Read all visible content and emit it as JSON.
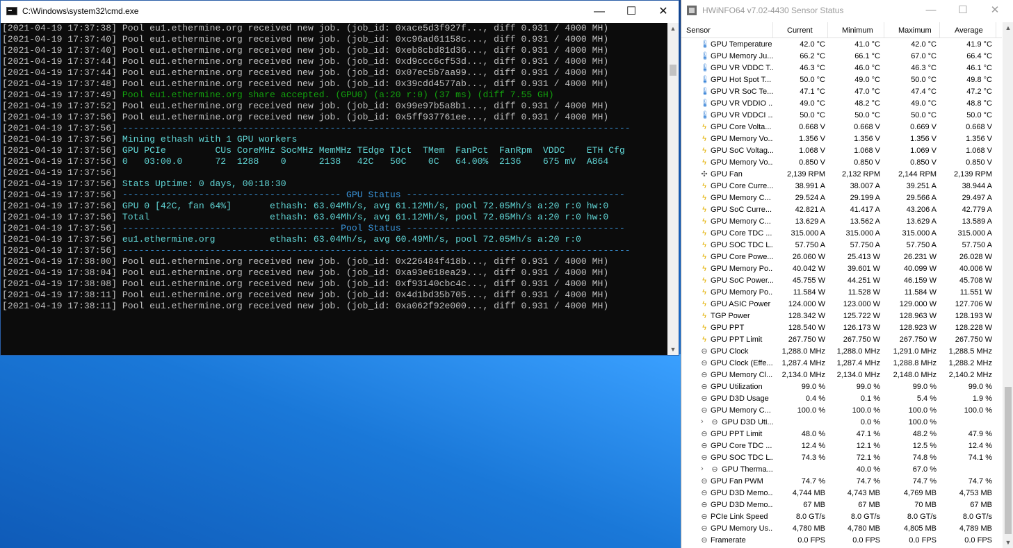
{
  "cmd": {
    "title": "C:\\Windows\\system32\\cmd.exe",
    "controls": {
      "minimize": "—",
      "maximize": "☐",
      "close": "✕"
    },
    "lines": [
      {
        "ts": "[2021-04-19 17:37:38]",
        "msg": " Pool eu1.ethermine.org received new job. (job_id: 0xace5d3f927f..., diff 0.931 / 4000 MH)",
        "color": "gray"
      },
      {
        "ts": "[2021-04-19 17:37:40]",
        "msg": " Pool eu1.ethermine.org received new job. (job_id: 0xc96ad61158c..., diff 0.931 / 4000 MH)",
        "color": "gray"
      },
      {
        "ts": "[2021-04-19 17:37:40]",
        "msg": " Pool eu1.ethermine.org received new job. (job_id: 0xeb8cbd81d36..., diff 0.931 / 4000 MH)",
        "color": "gray"
      },
      {
        "ts": "[2021-04-19 17:37:44]",
        "msg": " Pool eu1.ethermine.org received new job. (job_id: 0xd9ccc6cf53d..., diff 0.931 / 4000 MH)",
        "color": "gray"
      },
      {
        "ts": "[2021-04-19 17:37:44]",
        "msg": " Pool eu1.ethermine.org received new job. (job_id: 0x07ec5b7aa99..., diff 0.931 / 4000 MH)",
        "color": "gray"
      },
      {
        "ts": "[2021-04-19 17:37:48]",
        "msg": " Pool eu1.ethermine.org received new job. (job_id: 0x39cdd4577ab..., diff 0.931 / 4000 MH)",
        "color": "gray"
      },
      {
        "ts": "[2021-04-19 17:37:49]",
        "msg": " Pool eu1.ethermine.org share accepted. (GPU0) (a:20 r:0) (37 ms) (diff 7.55 GH)",
        "color": "green"
      },
      {
        "ts": "[2021-04-19 17:37:52]",
        "msg": " Pool eu1.ethermine.org received new job. (job_id: 0x99e97b5a8b1..., diff 0.931 / 4000 MH)",
        "color": "gray"
      },
      {
        "ts": "[2021-04-19 17:37:56]",
        "msg": " Pool eu1.ethermine.org received new job. (job_id: 0x5ff937761ee..., diff 0.931 / 4000 MH)",
        "color": "gray"
      },
      {
        "ts": "[2021-04-19 17:37:56]",
        "msg": " ---------------------------------------------------------------------------------------------",
        "color": "cyan"
      },
      {
        "ts": "[2021-04-19 17:37:56]",
        "msg": " Mining ethash with 1 GPU workers",
        "color": "teal"
      },
      {
        "ts": "[2021-04-19 17:37:56]",
        "msg": " GPU PCIe         CUs CoreMHz SocMHz MemMHz TEdge TJct  TMem  FanPct  FanRpm  VDDC    ETH Cfg",
        "color": "teal"
      },
      {
        "ts": "[2021-04-19 17:37:56]",
        "msg": " 0   03:00.0      72  1288    0      2138   42C   50C    0C   64.00%  2136    675 mV  A864",
        "color": "teal"
      },
      {
        "ts": "[2021-04-19 17:37:56]",
        "msg": "",
        "color": "gray"
      },
      {
        "ts": "[2021-04-19 17:37:56]",
        "msg": " Stats Uptime: 0 days, 00:18:30",
        "color": "teal"
      },
      {
        "ts": "[2021-04-19 17:37:56]",
        "msg": " ---------------------------------------- GPU Status ----------------------------------------",
        "color": "cyan"
      },
      {
        "ts": "[2021-04-19 17:37:56]",
        "msg": " GPU 0 [42C, fan 64%]       ethash: 63.04Mh/s, avg 61.12Mh/s, pool 72.05Mh/s a:20 r:0 hw:0",
        "color": "teal"
      },
      {
        "ts": "[2021-04-19 17:37:56]",
        "msg": " Total                      ethash: 63.04Mh/s, avg 61.12Mh/s, pool 72.05Mh/s a:20 r:0 hw:0",
        "color": "teal"
      },
      {
        "ts": "[2021-04-19 17:37:56]",
        "msg": " --------------------------------------- Pool Status ----------------------------------------",
        "color": "cyan"
      },
      {
        "ts": "[2021-04-19 17:37:56]",
        "msg": " eu1.ethermine.org          ethash: 63.04Mh/s, avg 60.49Mh/s, pool 72.05Mh/s a:20 r:0",
        "color": "teal"
      },
      {
        "ts": "[2021-04-19 17:37:56]",
        "msg": " ---------------------------------------------------------------------------------------------",
        "color": "cyan"
      },
      {
        "ts": "[2021-04-19 17:38:00]",
        "msg": " Pool eu1.ethermine.org received new job. (job_id: 0x226484f418b..., diff 0.931 / 4000 MH)",
        "color": "gray"
      },
      {
        "ts": "[2021-04-19 17:38:04]",
        "msg": " Pool eu1.ethermine.org received new job. (job_id: 0xa93e618ea29..., diff 0.931 / 4000 MH)",
        "color": "gray"
      },
      {
        "ts": "[2021-04-19 17:38:08]",
        "msg": " Pool eu1.ethermine.org received new job. (job_id: 0xf93140cbc4c..., diff 0.931 / 4000 MH)",
        "color": "gray"
      },
      {
        "ts": "[2021-04-19 17:38:11]",
        "msg": " Pool eu1.ethermine.org received new job. (job_id: 0x4d1bd35b705..., diff 0.931 / 4000 MH)",
        "color": "gray"
      },
      {
        "ts": "[2021-04-19 17:38:11]",
        "msg": " Pool eu1.ethermine.org received new job. (job_id: 0xa062f92e000..., diff 0.931 / 4000 MH)",
        "color": "gray"
      }
    ]
  },
  "hwinfo": {
    "title": "HWiNFO64 v7.02-4430 Sensor Status",
    "controls": {
      "minimize": "—",
      "maximize": "☐",
      "close": "✕"
    },
    "headers": {
      "sensor": "Sensor",
      "current": "Current",
      "minimum": "Minimum",
      "maximum": "Maximum",
      "average": "Average"
    },
    "rows": [
      {
        "icon": "temp",
        "name": "GPU Temperature",
        "cur": "42.0 °C",
        "min": "41.0 °C",
        "max": "42.0 °C",
        "avg": "41.9 °C"
      },
      {
        "icon": "temp",
        "name": "GPU Memory Ju...",
        "cur": "66.2 °C",
        "min": "66.1 °C",
        "max": "67.0 °C",
        "avg": "66.4 °C"
      },
      {
        "icon": "temp",
        "name": "GPU VR VDDC T...",
        "cur": "46.3 °C",
        "min": "46.0 °C",
        "max": "46.3 °C",
        "avg": "46.1 °C"
      },
      {
        "icon": "temp",
        "name": "GPU Hot Spot T...",
        "cur": "50.0 °C",
        "min": "49.0 °C",
        "max": "50.0 °C",
        "avg": "49.8 °C"
      },
      {
        "icon": "temp",
        "name": "GPU VR SoC Te...",
        "cur": "47.1 °C",
        "min": "47.0 °C",
        "max": "47.4 °C",
        "avg": "47.2 °C"
      },
      {
        "icon": "temp",
        "name": "GPU VR VDDIO ...",
        "cur": "49.0 °C",
        "min": "48.2 °C",
        "max": "49.0 °C",
        "avg": "48.8 °C"
      },
      {
        "icon": "temp",
        "name": "GPU VR VDDCI ...",
        "cur": "50.0 °C",
        "min": "50.0 °C",
        "max": "50.0 °C",
        "avg": "50.0 °C"
      },
      {
        "icon": "volt",
        "name": "GPU Core Volta...",
        "cur": "0.668 V",
        "min": "0.668 V",
        "max": "0.669 V",
        "avg": "0.668 V"
      },
      {
        "icon": "volt",
        "name": "GPU Memory Vo...",
        "cur": "1.356 V",
        "min": "1.356 V",
        "max": "1.356 V",
        "avg": "1.356 V"
      },
      {
        "icon": "volt",
        "name": "GPU SoC Voltag...",
        "cur": "1.068 V",
        "min": "1.068 V",
        "max": "1.069 V",
        "avg": "1.068 V"
      },
      {
        "icon": "volt",
        "name": "GPU Memory Vo...",
        "cur": "0.850 V",
        "min": "0.850 V",
        "max": "0.850 V",
        "avg": "0.850 V"
      },
      {
        "icon": "fan",
        "name": "GPU Fan",
        "cur": "2,139 RPM",
        "min": "2,132 RPM",
        "max": "2,144 RPM",
        "avg": "2,139 RPM"
      },
      {
        "icon": "volt",
        "name": "GPU Core Curre...",
        "cur": "38.991 A",
        "min": "38.007 A",
        "max": "39.251 A",
        "avg": "38.944 A"
      },
      {
        "icon": "volt",
        "name": "GPU Memory C...",
        "cur": "29.524 A",
        "min": "29.199 A",
        "max": "29.566 A",
        "avg": "29.497 A"
      },
      {
        "icon": "volt",
        "name": "GPU SoC Curre...",
        "cur": "42.821 A",
        "min": "41.417 A",
        "max": "43.206 A",
        "avg": "42.779 A"
      },
      {
        "icon": "volt",
        "name": "GPU Memory C...",
        "cur": "13.629 A",
        "min": "13.562 A",
        "max": "13.629 A",
        "avg": "13.589 A"
      },
      {
        "icon": "volt",
        "name": "GPU Core TDC ...",
        "cur": "315.000 A",
        "min": "315.000 A",
        "max": "315.000 A",
        "avg": "315.000 A"
      },
      {
        "icon": "volt",
        "name": "GPU SOC TDC L...",
        "cur": "57.750 A",
        "min": "57.750 A",
        "max": "57.750 A",
        "avg": "57.750 A"
      },
      {
        "icon": "volt",
        "name": "GPU Core Powe...",
        "cur": "26.060 W",
        "min": "25.413 W",
        "max": "26.231 W",
        "avg": "26.028 W"
      },
      {
        "icon": "volt",
        "name": "GPU Memory Po...",
        "cur": "40.042 W",
        "min": "39.601 W",
        "max": "40.099 W",
        "avg": "40.006 W"
      },
      {
        "icon": "volt",
        "name": "GPU SoC Power...",
        "cur": "45.755 W",
        "min": "44.251 W",
        "max": "46.159 W",
        "avg": "45.708 W"
      },
      {
        "icon": "volt",
        "name": "GPU Memory Po...",
        "cur": "11.584 W",
        "min": "11.528 W",
        "max": "11.584 W",
        "avg": "11.551 W"
      },
      {
        "icon": "volt",
        "name": "GPU ASIC Power",
        "cur": "124.000 W",
        "min": "123.000 W",
        "max": "129.000 W",
        "avg": "127.706 W"
      },
      {
        "icon": "volt",
        "name": "TGP Power",
        "cur": "128.342 W",
        "min": "125.722 W",
        "max": "128.963 W",
        "avg": "128.193 W"
      },
      {
        "icon": "volt",
        "name": "GPU PPT",
        "cur": "128.540 W",
        "min": "126.173 W",
        "max": "128.923 W",
        "avg": "128.228 W"
      },
      {
        "icon": "volt",
        "name": "GPU PPT Limit",
        "cur": "267.750 W",
        "min": "267.750 W",
        "max": "267.750 W",
        "avg": "267.750 W"
      },
      {
        "icon": "clock",
        "name": "GPU Clock",
        "cur": "1,288.0 MHz",
        "min": "1,288.0 MHz",
        "max": "1,291.0 MHz",
        "avg": "1,288.5 MHz"
      },
      {
        "icon": "clock",
        "name": "GPU Clock (Effe...",
        "cur": "1,287.4 MHz",
        "min": "1,287.4 MHz",
        "max": "1,288.8 MHz",
        "avg": "1,288.2 MHz"
      },
      {
        "icon": "clock",
        "name": "GPU Memory Cl...",
        "cur": "2,134.0 MHz",
        "min": "2,134.0 MHz",
        "max": "2,148.0 MHz",
        "avg": "2,140.2 MHz"
      },
      {
        "icon": "clock",
        "name": "GPU Utilization",
        "cur": "99.0 %",
        "min": "99.0 %",
        "max": "99.0 %",
        "avg": "99.0 %"
      },
      {
        "icon": "clock",
        "name": "GPU D3D Usage",
        "cur": "0.4 %",
        "min": "0.1 %",
        "max": "5.4 %",
        "avg": "1.9 %"
      },
      {
        "icon": "clock",
        "name": "GPU Memory C...",
        "cur": "100.0 %",
        "min": "100.0 %",
        "max": "100.0 %",
        "avg": "100.0 %"
      },
      {
        "icon": "clock",
        "name": "GPU D3D Uti...",
        "cur": "",
        "min": "0.0 %",
        "max": "100.0 %",
        "avg": "",
        "sub": true
      },
      {
        "icon": "clock",
        "name": "GPU PPT Limit",
        "cur": "48.0 %",
        "min": "47.1 %",
        "max": "48.2 %",
        "avg": "47.9 %"
      },
      {
        "icon": "clock",
        "name": "GPU Core TDC ...",
        "cur": "12.4 %",
        "min": "12.1 %",
        "max": "12.5 %",
        "avg": "12.4 %"
      },
      {
        "icon": "clock",
        "name": "GPU SOC TDC L...",
        "cur": "74.3 %",
        "min": "72.1 %",
        "max": "74.8 %",
        "avg": "74.1 %"
      },
      {
        "icon": "clock",
        "name": "GPU Therma...",
        "cur": "",
        "min": "40.0 %",
        "max": "67.0 %",
        "avg": "",
        "sub": true
      },
      {
        "icon": "clock",
        "name": "GPU Fan PWM",
        "cur": "74.7 %",
        "min": "74.7 %",
        "max": "74.7 %",
        "avg": "74.7 %"
      },
      {
        "icon": "clock",
        "name": "GPU D3D Memo...",
        "cur": "4,744 MB",
        "min": "4,743 MB",
        "max": "4,769 MB",
        "avg": "4,753 MB"
      },
      {
        "icon": "clock",
        "name": "GPU D3D Memo...",
        "cur": "67 MB",
        "min": "67 MB",
        "max": "70 MB",
        "avg": "67 MB"
      },
      {
        "icon": "clock",
        "name": "PCIe Link Speed",
        "cur": "8.0 GT/s",
        "min": "8.0 GT/s",
        "max": "8.0 GT/s",
        "avg": "8.0 GT/s"
      },
      {
        "icon": "clock",
        "name": "GPU Memory Us...",
        "cur": "4,780 MB",
        "min": "4,780 MB",
        "max": "4,805 MB",
        "avg": "4,789 MB"
      },
      {
        "icon": "clock",
        "name": "Framerate",
        "cur": "0.0 FPS",
        "min": "0.0 FPS",
        "max": "0.0 FPS",
        "avg": "0.0 FPS"
      }
    ]
  }
}
